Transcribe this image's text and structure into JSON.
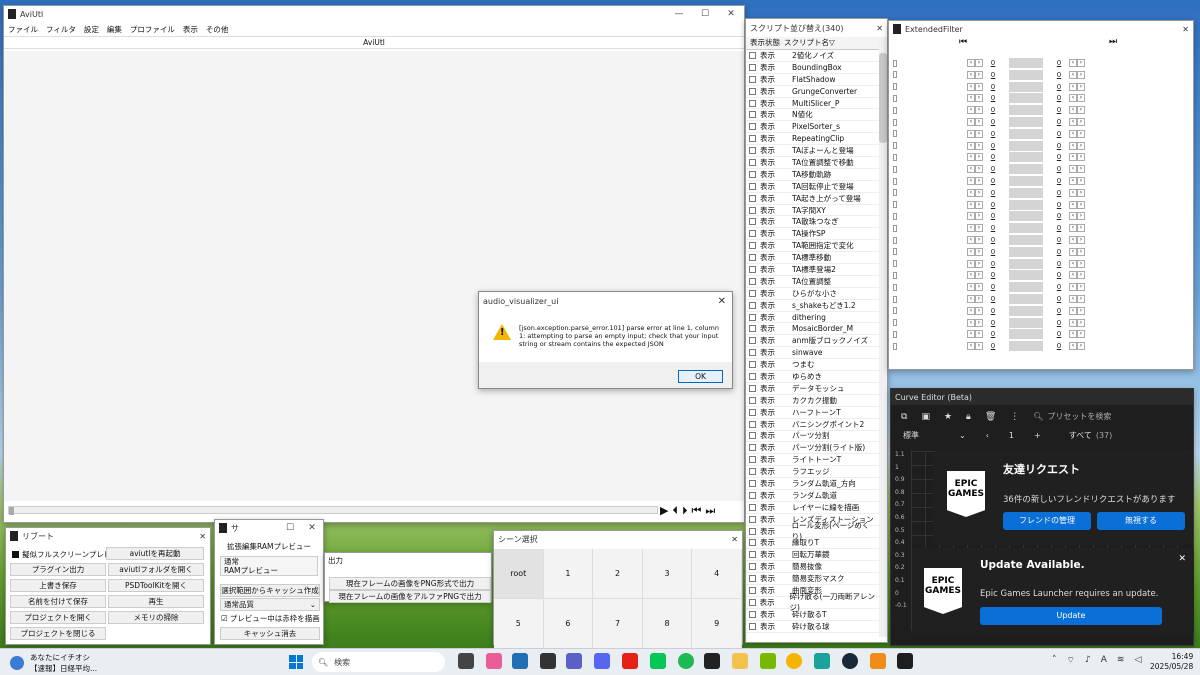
{
  "aviutl": {
    "title": "AviUtl",
    "menu": [
      "ファイル",
      "フィルタ",
      "設定",
      "編集",
      "プロファイル",
      "表示",
      "その他"
    ],
    "header": "AviUtl"
  },
  "dialog": {
    "title": "audio_visualizer_ui",
    "message": "[json.exception.parse_error.101] parse error at line 1, column 1: attempting to parse an empty input; check that your input string or stream contains the expected JSON",
    "ok": "OK"
  },
  "script_list": {
    "title": "スクリプト並び替え(340)",
    "col_state": "表示状態",
    "col_name": "スクリプト名▽",
    "show_label": "表示",
    "items": [
      "2値化ノイズ",
      "BoundingBox",
      "FlatShadow",
      "GrungeConverter",
      "MultiSlicer_P",
      "N値化",
      "PixelSorter_s",
      "RepeatingClip",
      "TAぼよーんと登場",
      "TA位置調整で移動",
      "TA移動軌跡",
      "TA回転停止で登場",
      "TA起き上がって登場",
      "TA字間XY",
      "TA散珠つなぎ",
      "TA操作SP",
      "TA範囲指定で変化",
      "TA標準移動",
      "TA標準登場2",
      "TA位置調整",
      "ひらがな小さ",
      "s_shakeもどき1.2",
      "dithering",
      "MosaicBorder_M",
      "anm版ブロックノイズ",
      "sinwave",
      "つまむ",
      "ゆらめき",
      "データモッシュ",
      "カクカク振動",
      "ハーフトーンT",
      "バニシングポイント2",
      "パーツ分割",
      "パーツ分割(ライト版)",
      "ライトトーンT",
      "ラフエッジ",
      "ランダム軌道_方向",
      "ランダム軌道",
      "レイヤーに線を描画",
      "レンズディストーション",
      "ロール変形(ページめくり)",
      "縁取りT",
      "回転万華鏡",
      "簡易抜像",
      "簡易変形マスク",
      "曲面変形",
      "砕け散る(一刀両断アレンジ)",
      "砕け散るT",
      "砕け散る球"
    ]
  },
  "extended_filter": {
    "title": "ExtendedFilter",
    "zero": "0",
    "row_count": 25
  },
  "curve_editor": {
    "title": "Curve Editor (Beta)",
    "search_placeholder": "プリセットを検索",
    "mode": "標準",
    "page": "1",
    "all_label": "すべて",
    "count": "(37)",
    "yticks": [
      "1.1",
      "1",
      "0.9",
      "0.8",
      "0.7",
      "0.6",
      "0.5",
      "0.4",
      "0.3",
      "0.2",
      "0.1",
      "0",
      "-0.1"
    ]
  },
  "notif1": {
    "logo": "EPIC GAMES",
    "title": "友達リクエスト",
    "body": "36件の新しいフレンドリクエストがあります",
    "btn1": "フレンドの管理",
    "btn2": "無視する"
  },
  "notif2": {
    "logo": "EPIC GAMES",
    "title": "Update Available.",
    "body": "Epic Games Launcher requires an update.",
    "btn": "Update"
  },
  "restart": {
    "title": "リブート",
    "check": "擬似フルスクリーンプレビュー",
    "buttons": [
      "aviutlを再起動",
      "プラグイン出力",
      "aviutlフォルダを開く",
      "上書き保存",
      "PSDToolKitを開く",
      "名前を付けて保存",
      "再生",
      "プロジェクトを開く",
      "メモリの掃除",
      "プロジェクトを閉じる"
    ]
  },
  "ram": {
    "title": "サ",
    "header": "拡張編集RAMプレビュー",
    "opt1": "通常",
    "opt2": "RAMプレビュー",
    "btn_cache": "選択範囲からキャッシュ作成",
    "quality": "通常品質",
    "check": "プレビュー中は赤枠を描画",
    "btn_clear": "キャッシュ消去"
  },
  "output": {
    "title": "出力",
    "btn1": "現在フレームの画像をPNG形式で出力",
    "btn2": "現在フレームの画像をアルファPNGで出力"
  },
  "scene": {
    "title": "シーン選択",
    "cells": [
      "root",
      "1",
      "2",
      "3",
      "4",
      "5",
      "6",
      "7",
      "8",
      "9"
    ]
  },
  "taskbar": {
    "news1": "あなたにイチオシ",
    "news2": "【速報】日経平均...",
    "search": "検索",
    "time": "16:49",
    "date": "2025/05/28"
  }
}
